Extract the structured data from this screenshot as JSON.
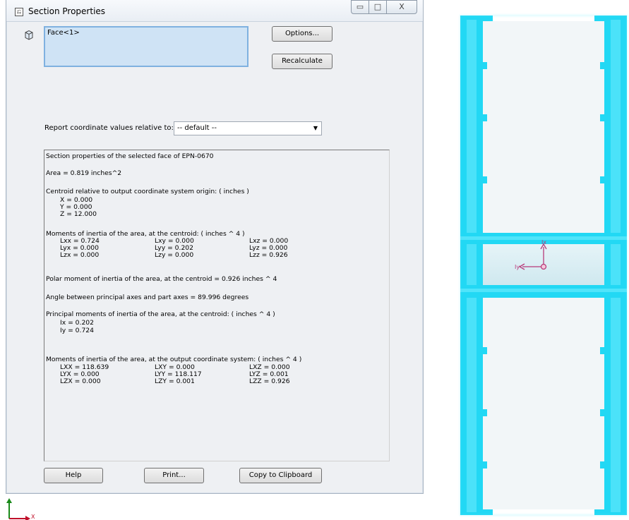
{
  "window": {
    "title": "Section Properties",
    "controls": {
      "minimize": "▭",
      "maximize": "□",
      "close": "X"
    }
  },
  "selection": {
    "items": [
      "Face<1>"
    ]
  },
  "buttons": {
    "options": "Options...",
    "recalculate": "Recalculate",
    "help": "Help",
    "print": "Print...",
    "copy": "Copy to Clipboard"
  },
  "report": {
    "label": "Report coordinate values relative to:",
    "selected": "-- default --"
  },
  "results": {
    "header": "Section properties of the selected face of EPN-0670",
    "area": "Area = 0.819 inches^2",
    "centroid_title": "Centroid relative to output coordinate system origin: ( inches )",
    "centroid": [
      "X = 0.000",
      "Y = 0.000",
      "Z = 12.000"
    ],
    "moi_centroid_title": "Moments of inertia of the area, at the centroid: ( inches ^ 4 )",
    "moi_centroid": [
      [
        "Lxx = 0.724",
        "Lxy = 0.000",
        "Lxz = 0.000"
      ],
      [
        "Lyx = 0.000",
        "Lyy = 0.202",
        "Lyz = 0.000"
      ],
      [
        "Lzx = 0.000",
        "Lzy = 0.000",
        "Lzz = 0.926"
      ]
    ],
    "polar": "Polar moment of inertia of the area, at the centroid = 0.926 inches ^ 4",
    "angle": "Angle between principal axes and part axes = 89.996 degrees",
    "principal_title": "Principal moments of inertia of the area, at the centroid: ( inches ^ 4 )",
    "principal": [
      "Ix = 0.202",
      "Iy = 0.724"
    ],
    "moi_output_title": "Moments of inertia of the area, at the output coordinate system: ( inches ^ 4 )",
    "moi_output": [
      [
        "LXX = 118.639",
        "LXY = 0.000",
        "LXZ = 0.000"
      ],
      [
        "LYX = 0.000",
        "LYY = 118.117",
        "LYZ = 0.001"
      ],
      [
        "LZX = 0.000",
        "LZY = 0.001",
        "LZZ = 0.926"
      ]
    ]
  },
  "graphics": {
    "profile_color": "#22d8f4",
    "axis_labels": {
      "x": "Ix",
      "y": "Iy"
    },
    "triad_label": "X"
  }
}
